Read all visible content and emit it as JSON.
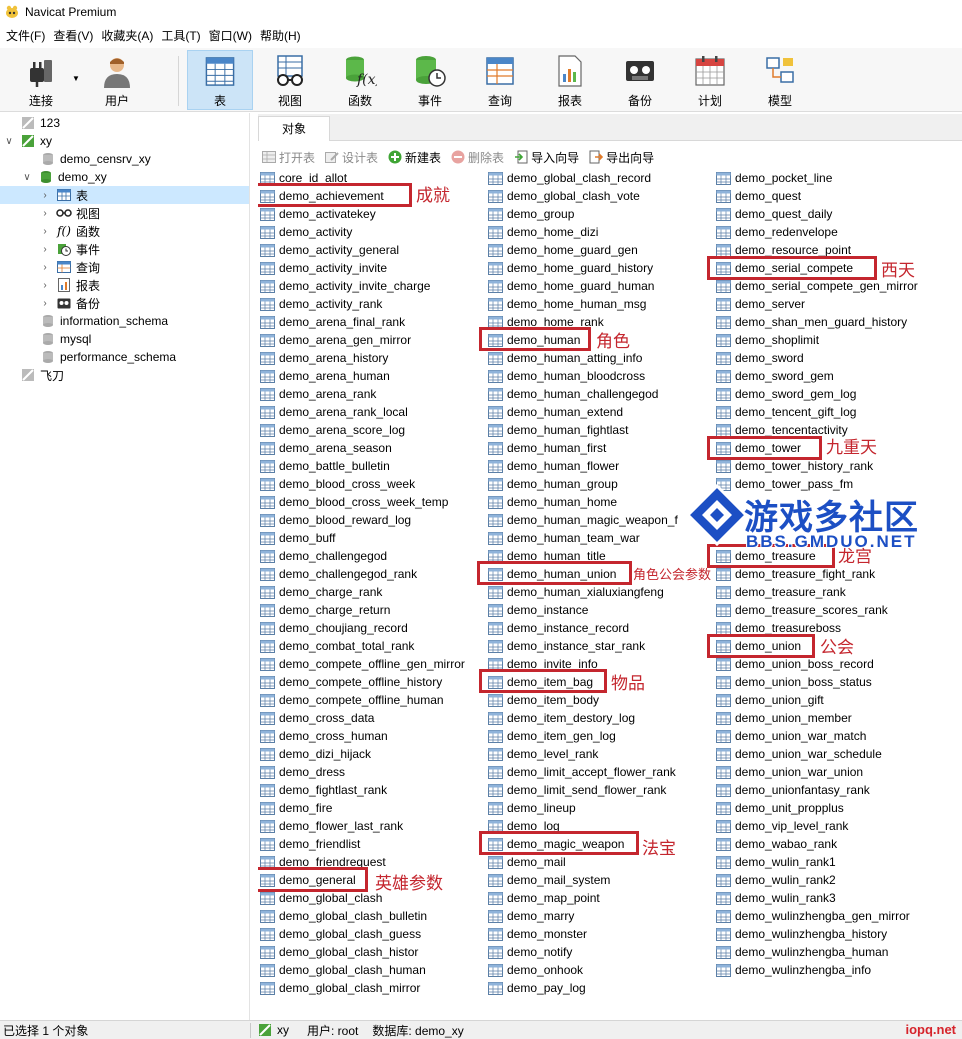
{
  "window": {
    "title": "Navicat Premium"
  },
  "menu": [
    "文件(F)",
    "查看(V)",
    "收藏夹(A)",
    "工具(T)",
    "窗口(W)",
    "帮助(H)"
  ],
  "toolbar": {
    "connect": "连接",
    "user": "用户",
    "table": "表",
    "view": "视图",
    "function": "函数",
    "event": "事件",
    "query": "查询",
    "report": "报表",
    "backup": "备份",
    "schedule": "计划",
    "model": "模型"
  },
  "tree": {
    "conn_123": "123",
    "conn_xy": "xy",
    "db_demo_censrv_xy": "demo_censrv_xy",
    "db_demo_xy": "demo_xy",
    "node_table": "表",
    "node_view": "视图",
    "node_function": "函数",
    "node_event": "事件",
    "node_query": "查询",
    "node_report": "报表",
    "node_backup": "备份",
    "db_information_schema": "information_schema",
    "db_mysql": "mysql",
    "db_performance_schema": "performance_schema",
    "conn_feidao": "飞刀"
  },
  "objects": {
    "tab": "对象",
    "open_table": "打开表",
    "design_table": "设计表",
    "new_table": "新建表",
    "delete_table": "删除表",
    "import_wizard": "导入向导",
    "export_wizard": "导出向导",
    "col1": [
      "core_id_allot",
      "demo_achievement",
      "demo_activatekey",
      "demo_activity",
      "demo_activity_general",
      "demo_activity_invite",
      "demo_activity_invite_charge",
      "demo_activity_rank",
      "demo_arena_final_rank",
      "demo_arena_gen_mirror",
      "demo_arena_history",
      "demo_arena_human",
      "demo_arena_rank",
      "demo_arena_rank_local",
      "demo_arena_score_log",
      "demo_arena_season",
      "demo_battle_bulletin",
      "demo_blood_cross_week",
      "demo_blood_cross_week_temp",
      "demo_blood_reward_log",
      "demo_buff",
      "demo_challengegod",
      "demo_challengegod_rank",
      "demo_charge_rank",
      "demo_charge_return",
      "demo_choujiang_record",
      "demo_combat_total_rank",
      "demo_compete_offline_gen_mirror",
      "demo_compete_offline_history",
      "demo_compete_offline_human",
      "demo_cross_data",
      "demo_cross_human",
      "demo_dizi_hijack",
      "demo_dress",
      "demo_fightlast_rank",
      "demo_fire",
      "demo_flower_last_rank",
      "demo_friendlist",
      "demo_friendrequest",
      "demo_general",
      "demo_global_clash",
      "demo_global_clash_bulletin",
      "demo_global_clash_guess",
      "demo_global_clash_histor",
      "demo_global_clash_human",
      "demo_global_clash_mirror"
    ],
    "col2": [
      "demo_global_clash_record",
      "demo_global_clash_vote",
      "demo_group",
      "demo_home_dizi",
      "demo_home_guard_gen",
      "demo_home_guard_history",
      "demo_home_guard_human",
      "demo_home_human_msg",
      "demo_home_rank",
      "demo_human",
      "demo_human_atting_info",
      "demo_human_bloodcross",
      "demo_human_challengegod",
      "demo_human_extend",
      "demo_human_fightlast",
      "demo_human_first",
      "demo_human_flower",
      "demo_human_group",
      "demo_human_home",
      "demo_human_magic_weapon_f",
      "demo_human_team_war",
      "demo_human_title",
      "demo_human_union",
      "demo_human_xialuxiangfeng",
      "demo_instance",
      "demo_instance_record",
      "demo_instance_star_rank",
      "demo_invite_info",
      "demo_item_bag",
      "demo_item_body",
      "demo_item_destory_log",
      "demo_item_gen_log",
      "demo_level_rank",
      "demo_limit_accept_flower_rank",
      "demo_limit_send_flower_rank",
      "demo_lineup",
      "demo_log",
      "demo_magic_weapon",
      "demo_mail",
      "demo_mail_system",
      "demo_map_point",
      "demo_marry",
      "demo_monster",
      "demo_notify",
      "demo_onhook",
      "demo_pay_log"
    ],
    "col3": [
      "demo_pocket_line",
      "demo_quest",
      "demo_quest_daily",
      "demo_redenvelope",
      "demo_resource_point",
      "demo_serial_compete",
      "demo_serial_compete_gen_mirror",
      "demo_server",
      "demo_shan_men_guard_history",
      "demo_shoplimit",
      "demo_sword",
      "demo_sword_gem",
      "demo_sword_gem_log",
      "demo_tencent_gift_log",
      "demo_tencentactivity",
      "demo_tower",
      "demo_tower_history_rank",
      "demo_tower_pass_fm",
      "",
      "",
      "",
      "demo_treasure",
      "demo_treasure_fight_rank",
      "demo_treasure_rank",
      "demo_treasure_scores_rank",
      "demo_treasureboss",
      "demo_union",
      "demo_union_boss_record",
      "demo_union_boss_status",
      "demo_union_gift",
      "demo_union_member",
      "demo_union_war_match",
      "demo_union_war_schedule",
      "demo_union_war_union",
      "demo_unionfantasy_rank",
      "demo_unit_propplus",
      "demo_vip_level_rank",
      "demo_wabao_rank",
      "demo_wulin_rank1",
      "demo_wulin_rank2",
      "demo_wulin_rank3",
      "demo_wulinzhengba_gen_mirror",
      "demo_wulinzhengba_history",
      "demo_wulinzhengba_human",
      "demo_wulinzhengba_info"
    ]
  },
  "annotations": {
    "achievement": "成就",
    "human": "角色",
    "human_union": "角色公会参数",
    "item_bag": "物品",
    "magic_weapon": "法宝",
    "general": "英雄参数",
    "serial_compete": "西天",
    "tower": "九重天",
    "treasure": "龙宫",
    "union": "公会"
  },
  "watermark": {
    "main": "游戏多社区",
    "sub": "BBS.GMDUO.NET"
  },
  "status": {
    "selected": "已选择 1 个对象",
    "connection": "xy",
    "user": "用户: root",
    "database": "数据库: demo_xy",
    "brand": "iopq.net"
  },
  "colors": {
    "highlight": "#c4262e",
    "selection": "#cce8ff",
    "toolbar_active": "#cce4f7",
    "watermark": "#1c4fc4"
  }
}
